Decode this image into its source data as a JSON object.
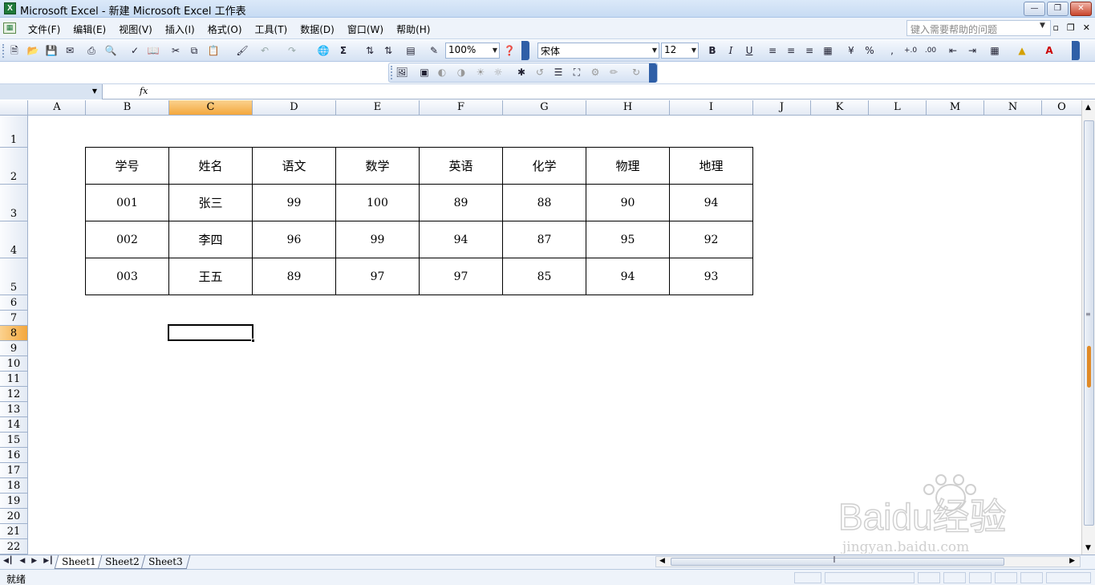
{
  "window": {
    "title": "Microsoft Excel - 新建 Microsoft Excel 工作表",
    "app_icon": "excel-icon",
    "controls": [
      "minimize-icon",
      "restore-icon",
      "close-icon"
    ]
  },
  "menubar": {
    "items": [
      "文件(F)",
      "编辑(E)",
      "视图(V)",
      "插入(I)",
      "格式(O)",
      "工具(T)",
      "数据(D)",
      "窗口(W)",
      "帮助(H)"
    ],
    "help_placeholder": "键入需要帮助的问题"
  },
  "toolbar": {
    "zoom": "100%",
    "font_name": "宋体",
    "font_size": "12",
    "bold": "B",
    "italic": "I",
    "underline": "U",
    "percent": "%",
    "comma": ","
  },
  "formula_bar": {
    "name_box": "",
    "fx": "fx",
    "content": ""
  },
  "grid": {
    "columns": [
      "A",
      "B",
      "C",
      "D",
      "E",
      "F",
      "G",
      "H",
      "I",
      "J",
      "K",
      "L",
      "M",
      "N",
      "O"
    ],
    "selected_column": "C",
    "rows": [
      "1",
      "2",
      "3",
      "4",
      "5",
      "6",
      "7",
      "8",
      "9",
      "10",
      "11",
      "12",
      "13",
      "14",
      "15",
      "16",
      "17",
      "18",
      "19",
      "20",
      "21",
      "22"
    ],
    "selected_row": "8"
  },
  "table": {
    "headers": [
      "学号",
      "姓名",
      "语文",
      "数学",
      "英语",
      "化学",
      "物理",
      "地理"
    ],
    "rows": [
      [
        "001",
        "张三",
        "99",
        "100",
        "89",
        "88",
        "90",
        "94"
      ],
      [
        "002",
        "李四",
        "96",
        "99",
        "94",
        "87",
        "95",
        "92"
      ],
      [
        "003",
        "王五",
        "89",
        "97",
        "97",
        "85",
        "94",
        "93"
      ]
    ]
  },
  "sheets": {
    "tabs": [
      "Sheet1",
      "Sheet2",
      "Sheet3"
    ],
    "active": "Sheet1"
  },
  "status": {
    "text": "就绪"
  },
  "watermark": {
    "text": "Baidu经验",
    "url": "jingyan.baidu.com"
  }
}
